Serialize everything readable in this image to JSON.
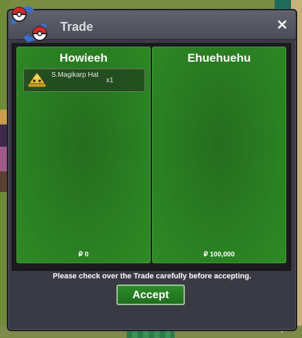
{
  "window": {
    "title": "Trade",
    "close_icon": "close-icon"
  },
  "left_panel": {
    "player": "Howieeh",
    "items": [
      {
        "name": "S.Magikarp Hat",
        "qty": "x1",
        "icon": "magikarp-hat-icon"
      }
    ],
    "money": "₽ 0"
  },
  "right_panel": {
    "player": "Ehuehuehu",
    "items": [],
    "money": "₽ 100,000"
  },
  "notice": "Please check over the Trade carefully before accepting.",
  "accept_label": "Accept",
  "colors": {
    "panel_green": "#2a7f22",
    "window_bg": "#3a3a44",
    "accept_green": "#2d8c2a"
  }
}
